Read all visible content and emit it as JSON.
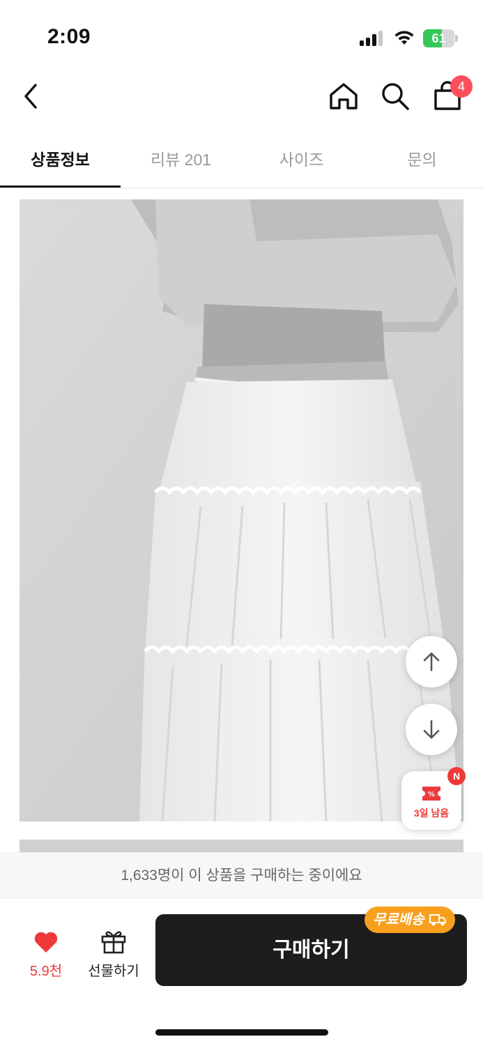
{
  "status_bar": {
    "time": "2:09",
    "battery_percent": 61,
    "battery_label": "61"
  },
  "nav": {
    "cart_badge": "4",
    "icons": [
      "back-chevron-icon",
      "home-icon",
      "search-icon",
      "shopping-bag-icon"
    ]
  },
  "tabs": [
    {
      "label": "상품정보",
      "active": true
    },
    {
      "label": "리뷰 201",
      "active": false
    },
    {
      "label": "사이즈",
      "active": false
    },
    {
      "label": "문의",
      "active": false
    }
  ],
  "floating": {
    "coupon_label": "3일 남음",
    "coupon_badge": "N",
    "icons": [
      "arrow-up-icon",
      "arrow-down-icon",
      "coupon-icon"
    ]
  },
  "bottom": {
    "purchase_notice": "1,633명이 이 상품을 구매하는 중이에요",
    "like_count": "5.9천",
    "gift_label": "선물하기",
    "buy_label": "구매하기",
    "free_shipping": "무료배송"
  },
  "colors": {
    "accent_red": "#ee3a3a",
    "badge_red": "#ff4f5b",
    "buy_button": "#1d1d1d",
    "shipping_orange": "#f8a01d",
    "battery_green": "#34c759"
  }
}
